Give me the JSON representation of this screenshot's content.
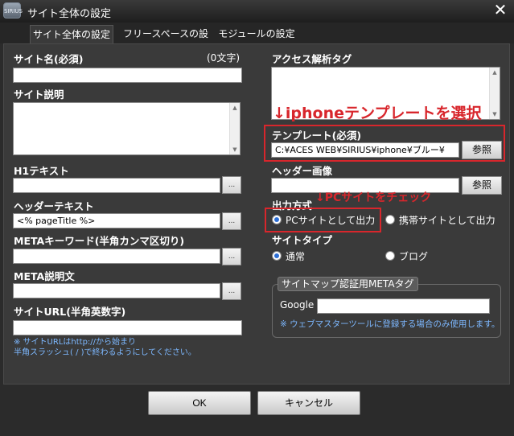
{
  "window": {
    "icon_text": "SIRIUS",
    "title": "サイト全体の設定",
    "close": "✕"
  },
  "tabs": [
    {
      "label": "サイト全体の設定"
    },
    {
      "label": "フリースペースの設定"
    },
    {
      "label": "モジュールの設定"
    }
  ],
  "left": {
    "site_name": {
      "label": "サイト名(必須)",
      "count": "(0文字)",
      "value": ""
    },
    "site_desc": {
      "label": "サイト説明",
      "value": ""
    },
    "h1_text": {
      "label": "H1テキスト",
      "value": ""
    },
    "header_text": {
      "label": "ヘッダーテキスト",
      "value": "<% pageTitle %>"
    },
    "meta_keywords": {
      "label": "METAキーワード(半角カンマ区切り)",
      "value": ""
    },
    "meta_desc": {
      "label": "META説明文",
      "value": ""
    },
    "site_url": {
      "label": "サイトURL(半角英数字)",
      "value": ""
    },
    "url_note_1": "※ サイトURLはhttp://から始まり",
    "url_note_2": "半角スラッシュ( / )で終わるようにしてください。",
    "browse_label": "..."
  },
  "right": {
    "access_tag": {
      "label": "アクセス解析タグ",
      "value": ""
    },
    "annotation_template": "↓iphoneテンプレートを選択",
    "template": {
      "label": "テンプレート(必須)",
      "value": "C:¥ACES WEB¥SIRIUS¥iphone¥ブルー¥",
      "button": "参照"
    },
    "header_image": {
      "label": "ヘッダー画像",
      "value": "",
      "button": "参照"
    },
    "annotation_output": "↓PCサイトをチェック",
    "output_mode": {
      "label": "出力方式",
      "options": [
        "PCサイトとして出力",
        "携帯サイトとして出力"
      ],
      "selected": 0
    },
    "site_type": {
      "label": "サイトタイプ",
      "options": [
        "通常",
        "ブログ"
      ],
      "selected": 0
    },
    "sitemap": {
      "title": "サイトマップ認証用METAタグ",
      "google_label": "Google",
      "google_value": "",
      "note": "※ ウェブマスターツールに登録する場合のみ使用します。"
    }
  },
  "footer": {
    "ok": "OK",
    "cancel": "キャンセル"
  },
  "colors": {
    "annotation_red": "#d8262c",
    "note_blue": "#7db8ff",
    "radio_selected": "#2d6fd6"
  }
}
